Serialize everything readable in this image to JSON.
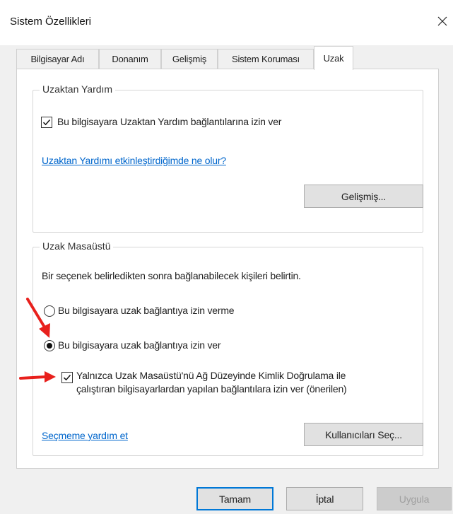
{
  "window": {
    "title": "Sistem Özellikleri",
    "close_icon": "close-icon"
  },
  "tabs": [
    {
      "label": "Bilgisayar Adı",
      "active": false
    },
    {
      "label": "Donanım",
      "active": false
    },
    {
      "label": "Gelişmiş",
      "active": false
    },
    {
      "label": "Sistem Koruması",
      "active": false
    },
    {
      "label": "Uzak",
      "active": true
    }
  ],
  "remote_assistance": {
    "legend": "Uzaktan Yardım",
    "allow_checkbox_label": "Bu bilgisayara Uzaktan Yardım bağlantılarına izin ver",
    "allow_checked": true,
    "help_link": "Uzaktan Yardımı etkinleştirdiğimde ne olur?",
    "advanced_button": "Gelişmiş..."
  },
  "remote_desktop": {
    "legend": "Uzak Masaüstü",
    "instruction": "Bir seçenek belirledikten sonra bağlanabilecek kişileri belirtin.",
    "option_deny": "Bu bilgisayara uzak bağlantıya izin verme",
    "option_allow": "Bu bilgisayara uzak bağlantıya izin ver",
    "selected_option": "allow",
    "nla_line1": "Yalnızca Uzak Masaüstü'nü Ağ Düzeyinde Kimlik Doğrulama ile",
    "nla_line2": "çalıştıran bilgisayarlardan yapılan bağlantılara izin ver (önerilen)",
    "nla_checked": true,
    "help_link": "Seçmeme yardım et",
    "select_users_button": "Kullanıcıları Seç..."
  },
  "footer": {
    "ok": "Tamam",
    "cancel": "İptal",
    "apply": "Uygula"
  },
  "colors": {
    "link": "#0066cc",
    "arrow": "#e8201c",
    "primary_border": "#0078d7"
  }
}
